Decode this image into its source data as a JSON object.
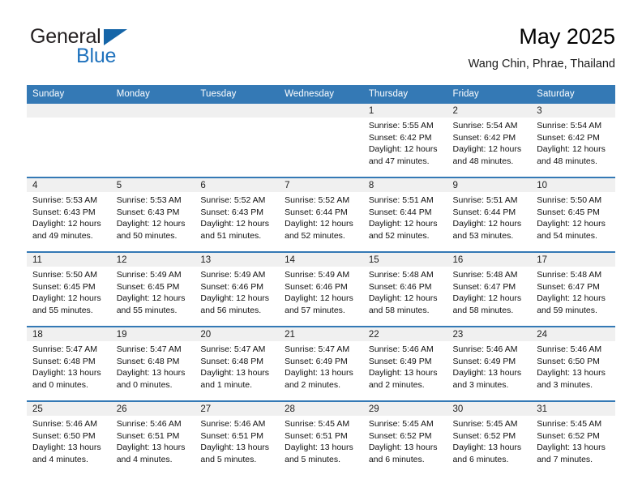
{
  "brand": {
    "name_part1": "General",
    "name_part2": "Blue",
    "triangle_color": "#1565a8",
    "blue_text_color": "#1f72bd"
  },
  "header": {
    "title": "May 2025",
    "subtitle": "Wang Chin, Phrae, Thailand"
  },
  "theme": {
    "header_row_color": "#3479b5",
    "daynum_band_color": "#f0f0f0",
    "separator_color": "#3479b5"
  },
  "weekday_headers": [
    "Sunday",
    "Monday",
    "Tuesday",
    "Wednesday",
    "Thursday",
    "Friday",
    "Saturday"
  ],
  "weeks": [
    [
      {
        "day": "",
        "sunrise": "",
        "sunset": "",
        "daylight1": "",
        "daylight2": ""
      },
      {
        "day": "",
        "sunrise": "",
        "sunset": "",
        "daylight1": "",
        "daylight2": ""
      },
      {
        "day": "",
        "sunrise": "",
        "sunset": "",
        "daylight1": "",
        "daylight2": ""
      },
      {
        "day": "",
        "sunrise": "",
        "sunset": "",
        "daylight1": "",
        "daylight2": ""
      },
      {
        "day": "1",
        "sunrise": "Sunrise: 5:55 AM",
        "sunset": "Sunset: 6:42 PM",
        "daylight1": "Daylight: 12 hours",
        "daylight2": "and 47 minutes."
      },
      {
        "day": "2",
        "sunrise": "Sunrise: 5:54 AM",
        "sunset": "Sunset: 6:42 PM",
        "daylight1": "Daylight: 12 hours",
        "daylight2": "and 48 minutes."
      },
      {
        "day": "3",
        "sunrise": "Sunrise: 5:54 AM",
        "sunset": "Sunset: 6:42 PM",
        "daylight1": "Daylight: 12 hours",
        "daylight2": "and 48 minutes."
      }
    ],
    [
      {
        "day": "4",
        "sunrise": "Sunrise: 5:53 AM",
        "sunset": "Sunset: 6:43 PM",
        "daylight1": "Daylight: 12 hours",
        "daylight2": "and 49 minutes."
      },
      {
        "day": "5",
        "sunrise": "Sunrise: 5:53 AM",
        "sunset": "Sunset: 6:43 PM",
        "daylight1": "Daylight: 12 hours",
        "daylight2": "and 50 minutes."
      },
      {
        "day": "6",
        "sunrise": "Sunrise: 5:52 AM",
        "sunset": "Sunset: 6:43 PM",
        "daylight1": "Daylight: 12 hours",
        "daylight2": "and 51 minutes."
      },
      {
        "day": "7",
        "sunrise": "Sunrise: 5:52 AM",
        "sunset": "Sunset: 6:44 PM",
        "daylight1": "Daylight: 12 hours",
        "daylight2": "and 52 minutes."
      },
      {
        "day": "8",
        "sunrise": "Sunrise: 5:51 AM",
        "sunset": "Sunset: 6:44 PM",
        "daylight1": "Daylight: 12 hours",
        "daylight2": "and 52 minutes."
      },
      {
        "day": "9",
        "sunrise": "Sunrise: 5:51 AM",
        "sunset": "Sunset: 6:44 PM",
        "daylight1": "Daylight: 12 hours",
        "daylight2": "and 53 minutes."
      },
      {
        "day": "10",
        "sunrise": "Sunrise: 5:50 AM",
        "sunset": "Sunset: 6:45 PM",
        "daylight1": "Daylight: 12 hours",
        "daylight2": "and 54 minutes."
      }
    ],
    [
      {
        "day": "11",
        "sunrise": "Sunrise: 5:50 AM",
        "sunset": "Sunset: 6:45 PM",
        "daylight1": "Daylight: 12 hours",
        "daylight2": "and 55 minutes."
      },
      {
        "day": "12",
        "sunrise": "Sunrise: 5:49 AM",
        "sunset": "Sunset: 6:45 PM",
        "daylight1": "Daylight: 12 hours",
        "daylight2": "and 55 minutes."
      },
      {
        "day": "13",
        "sunrise": "Sunrise: 5:49 AM",
        "sunset": "Sunset: 6:46 PM",
        "daylight1": "Daylight: 12 hours",
        "daylight2": "and 56 minutes."
      },
      {
        "day": "14",
        "sunrise": "Sunrise: 5:49 AM",
        "sunset": "Sunset: 6:46 PM",
        "daylight1": "Daylight: 12 hours",
        "daylight2": "and 57 minutes."
      },
      {
        "day": "15",
        "sunrise": "Sunrise: 5:48 AM",
        "sunset": "Sunset: 6:46 PM",
        "daylight1": "Daylight: 12 hours",
        "daylight2": "and 58 minutes."
      },
      {
        "day": "16",
        "sunrise": "Sunrise: 5:48 AM",
        "sunset": "Sunset: 6:47 PM",
        "daylight1": "Daylight: 12 hours",
        "daylight2": "and 58 minutes."
      },
      {
        "day": "17",
        "sunrise": "Sunrise: 5:48 AM",
        "sunset": "Sunset: 6:47 PM",
        "daylight1": "Daylight: 12 hours",
        "daylight2": "and 59 minutes."
      }
    ],
    [
      {
        "day": "18",
        "sunrise": "Sunrise: 5:47 AM",
        "sunset": "Sunset: 6:48 PM",
        "daylight1": "Daylight: 13 hours",
        "daylight2": "and 0 minutes."
      },
      {
        "day": "19",
        "sunrise": "Sunrise: 5:47 AM",
        "sunset": "Sunset: 6:48 PM",
        "daylight1": "Daylight: 13 hours",
        "daylight2": "and 0 minutes."
      },
      {
        "day": "20",
        "sunrise": "Sunrise: 5:47 AM",
        "sunset": "Sunset: 6:48 PM",
        "daylight1": "Daylight: 13 hours",
        "daylight2": "and 1 minute."
      },
      {
        "day": "21",
        "sunrise": "Sunrise: 5:47 AM",
        "sunset": "Sunset: 6:49 PM",
        "daylight1": "Daylight: 13 hours",
        "daylight2": "and 2 minutes."
      },
      {
        "day": "22",
        "sunrise": "Sunrise: 5:46 AM",
        "sunset": "Sunset: 6:49 PM",
        "daylight1": "Daylight: 13 hours",
        "daylight2": "and 2 minutes."
      },
      {
        "day": "23",
        "sunrise": "Sunrise: 5:46 AM",
        "sunset": "Sunset: 6:49 PM",
        "daylight1": "Daylight: 13 hours",
        "daylight2": "and 3 minutes."
      },
      {
        "day": "24",
        "sunrise": "Sunrise: 5:46 AM",
        "sunset": "Sunset: 6:50 PM",
        "daylight1": "Daylight: 13 hours",
        "daylight2": "and 3 minutes."
      }
    ],
    [
      {
        "day": "25",
        "sunrise": "Sunrise: 5:46 AM",
        "sunset": "Sunset: 6:50 PM",
        "daylight1": "Daylight: 13 hours",
        "daylight2": "and 4 minutes."
      },
      {
        "day": "26",
        "sunrise": "Sunrise: 5:46 AM",
        "sunset": "Sunset: 6:51 PM",
        "daylight1": "Daylight: 13 hours",
        "daylight2": "and 4 minutes."
      },
      {
        "day": "27",
        "sunrise": "Sunrise: 5:46 AM",
        "sunset": "Sunset: 6:51 PM",
        "daylight1": "Daylight: 13 hours",
        "daylight2": "and 5 minutes."
      },
      {
        "day": "28",
        "sunrise": "Sunrise: 5:45 AM",
        "sunset": "Sunset: 6:51 PM",
        "daylight1": "Daylight: 13 hours",
        "daylight2": "and 5 minutes."
      },
      {
        "day": "29",
        "sunrise": "Sunrise: 5:45 AM",
        "sunset": "Sunset: 6:52 PM",
        "daylight1": "Daylight: 13 hours",
        "daylight2": "and 6 minutes."
      },
      {
        "day": "30",
        "sunrise": "Sunrise: 5:45 AM",
        "sunset": "Sunset: 6:52 PM",
        "daylight1": "Daylight: 13 hours",
        "daylight2": "and 6 minutes."
      },
      {
        "day": "31",
        "sunrise": "Sunrise: 5:45 AM",
        "sunset": "Sunset: 6:52 PM",
        "daylight1": "Daylight: 13 hours",
        "daylight2": "and 7 minutes."
      }
    ]
  ]
}
